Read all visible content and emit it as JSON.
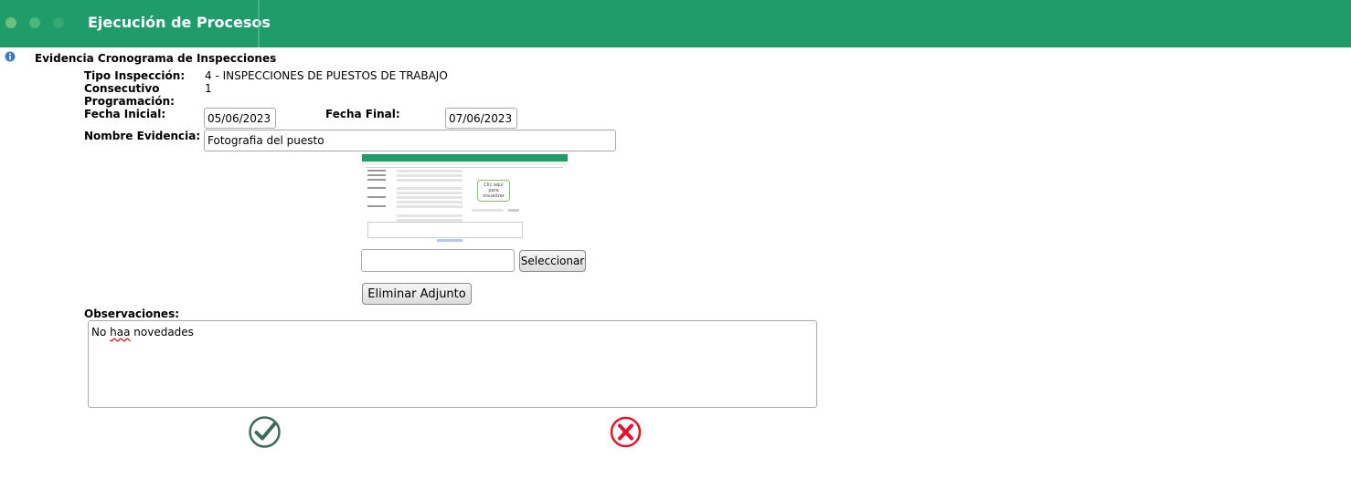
{
  "header": {
    "title": "Ejecución de Procesos"
  },
  "section": {
    "title": "Evidencia Cronograma de Inspecciones"
  },
  "form": {
    "tipo_label": "Tipo Inspección:",
    "tipo_value": "4 - INSPECCIONES DE PUESTOS DE TRABAJO",
    "consecutivo_label_1": "Consecutivo",
    "consecutivo_label_2": "Programación:",
    "consecutivo_value": "1",
    "fecha_inicial_label": "Fecha Inicial:",
    "fecha_inicial_value": "05/06/2023",
    "fecha_final_label": "Fecha Final:",
    "fecha_final_value": "07/06/2023",
    "nombre_label": "Nombre Evidencia:",
    "nombre_value": "Fotografia del puesto"
  },
  "attachment": {
    "thumbnail_caption_1": "Clic aquí",
    "thumbnail_caption_2": "para",
    "thumbnail_caption_3": "visualizar",
    "file_value": "",
    "select_button": "Seleccionar",
    "delete_button": "Eliminar Adjunto"
  },
  "observations": {
    "label": "Observaciones:",
    "text_part1": "No ",
    "text_misspelled": "haa",
    "text_part2": " novedades"
  },
  "actions": {
    "confirm_icon": "check-circle-icon",
    "cancel_icon": "x-circle-icon"
  },
  "colors": {
    "header": "#1f9c6a",
    "confirm": "#3d6b57",
    "cancel": "#e0142a"
  }
}
